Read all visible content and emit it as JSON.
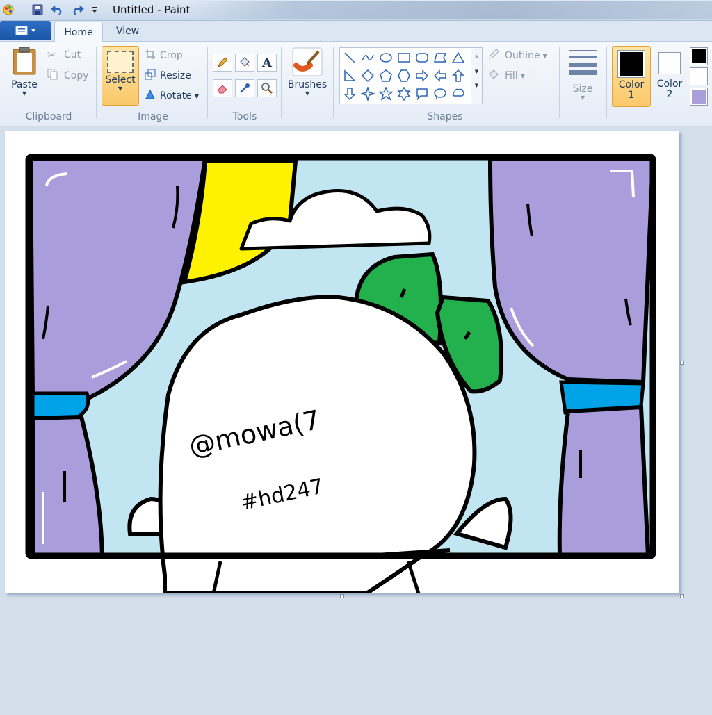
{
  "window": {
    "title": "Untitled - Paint"
  },
  "tabs": {
    "home": "Home",
    "view": "View"
  },
  "clipboard": {
    "paste": "Paste",
    "cut": "Cut",
    "copy": "Copy",
    "group": "Clipboard"
  },
  "image": {
    "select": "Select",
    "crop": "Crop",
    "resize": "Resize",
    "rotate": "Rotate",
    "group": "Image"
  },
  "tools": {
    "group": "Tools",
    "items": [
      "pencil-icon",
      "fill-bucket-icon",
      "text-icon",
      "eraser-icon",
      "color-picker-icon",
      "magnifier-icon"
    ]
  },
  "brushes": {
    "label": "Brushes"
  },
  "shapes": {
    "group": "Shapes",
    "outline": "Outline",
    "fill": "Fill"
  },
  "size": {
    "label": "Size"
  },
  "colors": {
    "color1_label_a": "Color",
    "color1_label_b": "1",
    "color2_label_a": "Color",
    "color2_label_b": "2",
    "color1": "#000000",
    "color2": "#ffffff",
    "palette": [
      "#000000",
      "#ffffff",
      "#a99ddb"
    ]
  },
  "drawing": {
    "handwriting_line1": "@mowa(7",
    "handwriting_line2": "#hd247",
    "palette_used": {
      "curtain": "#a99ddb",
      "sky": "#c2e6f1",
      "sun": "#fff200",
      "tie": "#00a2e8",
      "bow": "#22b14c"
    }
  }
}
